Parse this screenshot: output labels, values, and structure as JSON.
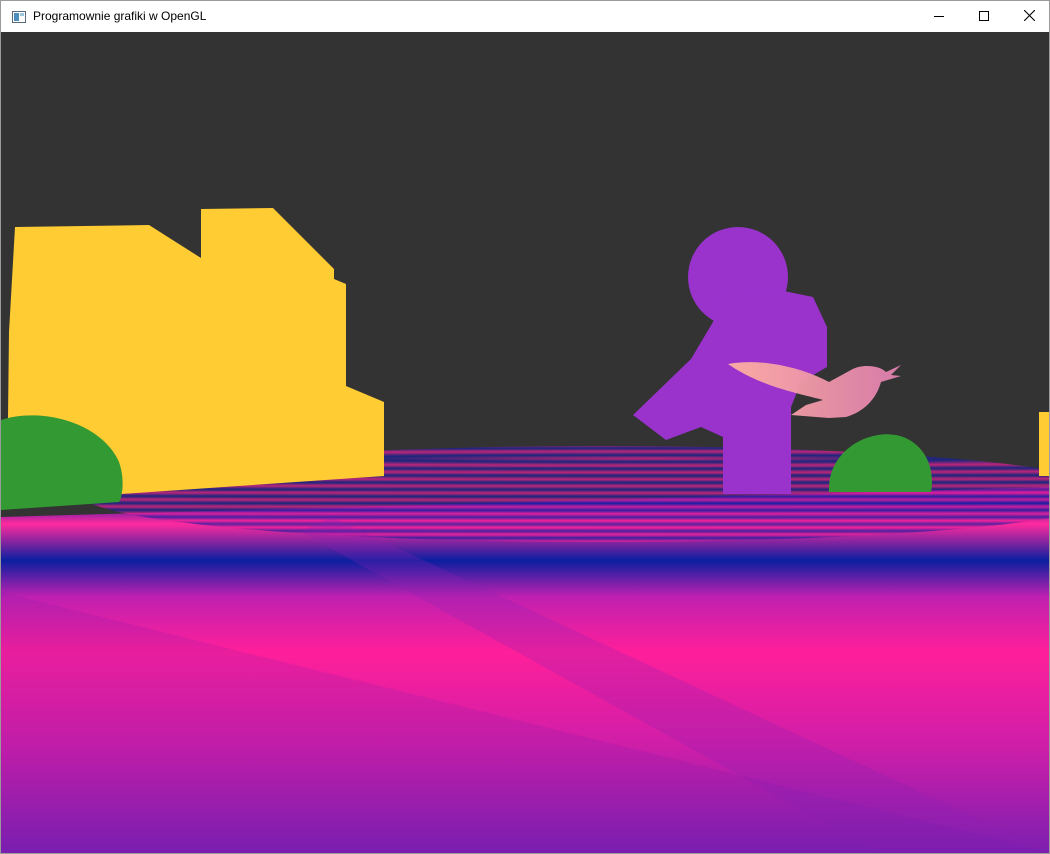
{
  "window": {
    "title": "Programownie grafiki w OpenGL",
    "icon": "opengl-window-icon",
    "controls": {
      "minimize_icon": "minimize-icon",
      "maximize_icon": "maximize-icon",
      "close_icon": "close-icon"
    }
  },
  "scene": {
    "type": "opengl-3d-render",
    "colors": {
      "background": "#333333",
      "building": "#ffcc33",
      "bush": "#339933",
      "character": "#9933cc",
      "bird": "#f0a090",
      "floor_pink": "#ff1f9a",
      "floor_blue": "#0a1fa0",
      "floor_purple": "#7b1fb0"
    },
    "objects": [
      "yellow-building",
      "left-bush",
      "right-bush",
      "purple-figure",
      "bird",
      "ripple-floor",
      "distant-yellow-object"
    ]
  }
}
